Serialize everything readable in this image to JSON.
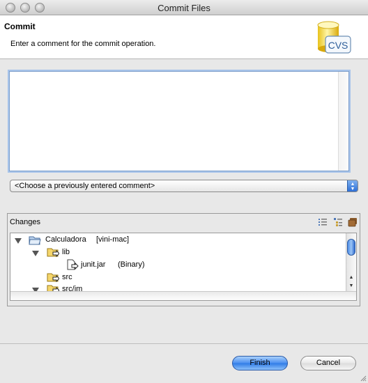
{
  "window": {
    "title": "Commit Files"
  },
  "banner": {
    "title": "Commit",
    "message": "Enter a comment for the commit operation.",
    "logo_text": "CVS"
  },
  "comment": {
    "value": ""
  },
  "previous_comments": {
    "selected": "<Choose a previously entered comment>"
  },
  "changes": {
    "label": "Changes",
    "tree": [
      {
        "label": "Calculadora",
        "detail": "[vini-mac]",
        "icon": "project-folder-icon",
        "expanded": true
      },
      {
        "label": "lib",
        "detail": "",
        "icon": "outgoing-folder-icon",
        "expanded": true
      },
      {
        "label": "junit.jar",
        "detail": "(Binary)",
        "icon": "outgoing-file-icon",
        "expanded": false
      },
      {
        "label": "src",
        "detail": "",
        "icon": "outgoing-folder-icon",
        "expanded": false
      },
      {
        "label": "src/jm",
        "detail": "",
        "icon": "outgoing-folder-icon",
        "expanded": true
      }
    ]
  },
  "buttons": {
    "finish": "Finish",
    "cancel": "Cancel"
  },
  "colors": {
    "accent": "#3b82ea",
    "focus_ring": "#a8c4ea"
  }
}
